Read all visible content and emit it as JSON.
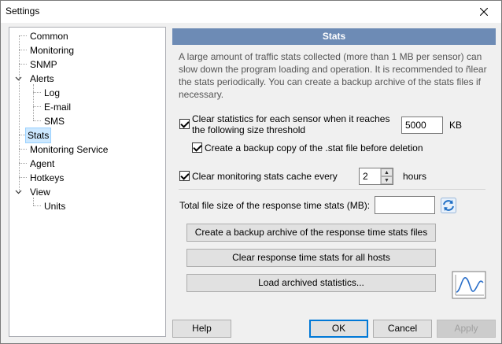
{
  "window": {
    "title": "Settings",
    "close_glyph": "✕"
  },
  "tree": {
    "items": [
      {
        "label": "Common"
      },
      {
        "label": "Monitoring"
      },
      {
        "label": "SNMP"
      },
      {
        "label": "Alerts"
      },
      {
        "label": "Log"
      },
      {
        "label": "E-mail"
      },
      {
        "label": "SMS"
      },
      {
        "label": "Stats"
      },
      {
        "label": "Monitoring Service"
      },
      {
        "label": "Agent"
      },
      {
        "label": "Hotkeys"
      },
      {
        "label": "View"
      },
      {
        "label": "Units"
      }
    ],
    "selected": "Stats"
  },
  "panel": {
    "header": "Stats",
    "description": "A large amount of traffic stats collected (more than 1 MB per sensor) can slow down the program loading and operation. It is recommended to ñlear the stats periodically. You can create a backup archive of the stats files if necessary.",
    "clear_threshold": {
      "checked": true,
      "label_line1": "Clear statistics for each sensor when it reaches",
      "label_line2": "the following size threshold",
      "value": "5000",
      "unit": "KB"
    },
    "backup_copy": {
      "checked": true,
      "label": "Create a backup copy of the .stat file before deletion"
    },
    "clear_cache": {
      "checked": true,
      "label": "Clear monitoring stats cache every",
      "value": "2",
      "unit": "hours"
    },
    "total_size": {
      "label": "Total file size of the response time stats (MB):",
      "value": ""
    },
    "buttons": {
      "create_archive": "Create a backup archive of the response time stats files",
      "clear_response": "Clear response time stats for all hosts",
      "load_archived": "Load archived statistics..."
    }
  },
  "footer": {
    "help": "Help",
    "ok": "OK",
    "cancel": "Cancel",
    "apply": "Apply"
  },
  "icons": {
    "close": "close-icon",
    "refresh": "refresh-icon",
    "chart": "chart-icon"
  },
  "colors": {
    "header_bg": "#6d8bb5",
    "selection_bg": "#cce8ff",
    "default_button_border": "#0078d7"
  }
}
